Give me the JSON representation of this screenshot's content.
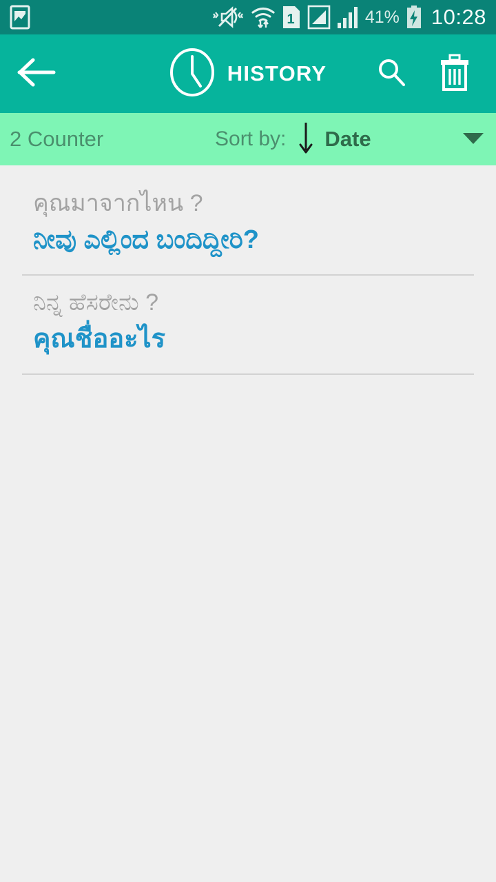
{
  "statusbar": {
    "left_icons": [
      {
        "name": "screenshot-icon"
      }
    ],
    "right_icons": [
      {
        "name": "vibrate-mute-icon"
      },
      {
        "name": "wifi-transfer-icon"
      },
      {
        "name": "sim-1-icon",
        "label": "1"
      },
      {
        "name": "signal-bars-boxed-icon"
      },
      {
        "name": "signal-bars-icon"
      }
    ],
    "battery_percent": "41%",
    "battery_icon": "battery-charging-icon",
    "time": "10:28"
  },
  "toolbar": {
    "back_icon": "arrow-left-icon",
    "title_icon": "clock-icon",
    "title": "HISTORY",
    "search_icon": "search-icon",
    "delete_icon": "trash-icon"
  },
  "sortbar": {
    "counter": "2 Counter",
    "sort_by_label": "Sort by:",
    "sort_direction_icon": "arrow-down-icon",
    "sort_value": "Date",
    "dropdown_icon": "caret-down-icon"
  },
  "history": {
    "entries": [
      {
        "source": "คุณมาจากไหน ?",
        "translation": "ನೀವು ಎಲ್ಲಿಂದ ಬಂದಿದ್ದೀರಿ?"
      },
      {
        "source": "ನಿನ್ನ ಹೆಸರೇನು ?",
        "translation": "คุณชื่ออะไร"
      }
    ]
  },
  "colors": {
    "statusbar_bg": "#0a8377",
    "toolbar_bg": "#06b49c",
    "sortbar_bg": "#7ef5b5",
    "body_bg": "#efefef",
    "source_text": "#a3a3a3",
    "translation_text": "#1f93c8",
    "divider": "#d2d2d2"
  }
}
